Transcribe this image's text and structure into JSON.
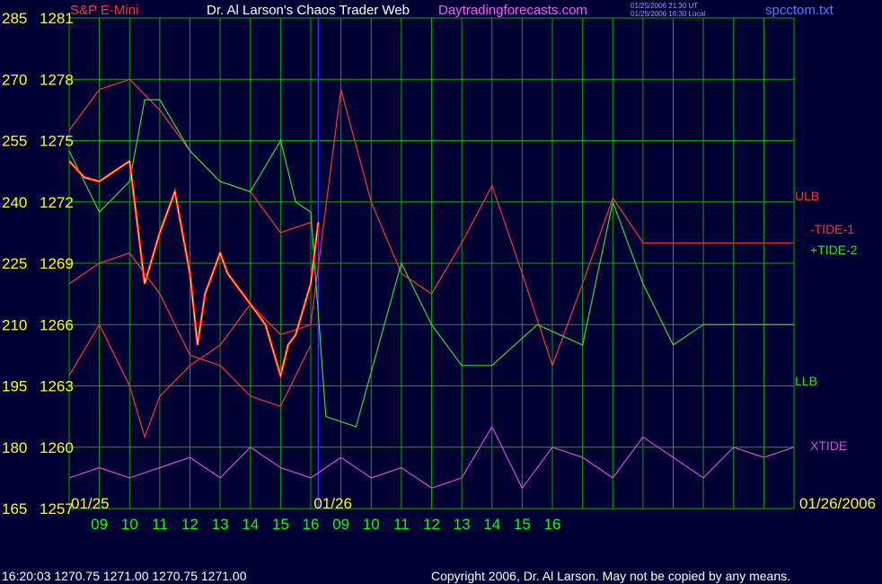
{
  "header": {
    "symbol": "S&P E-Mini",
    "title": "Dr. Al Larson's Chaos Trader Web",
    "site": "Daytradingforecasts.com",
    "timestamp_ut": "01/25/2006 21:30 UT",
    "timestamp_local": "01/25/2006 16:30 Local",
    "file": "spcctom.txt"
  },
  "footer": {
    "quote": "16:20:03  1270.75 1271.00 1270.75 1271.00",
    "copyright": "Copyright 2006, Dr. Al Larson. May not be copied by any means."
  },
  "colors": {
    "background": "#000033",
    "grid": "#00aa00",
    "price": "#ff0000",
    "price_up": "#ffffff",
    "ulb_llb": "#ff3333",
    "tide1": "#ff3333",
    "tide2": "#33dd33",
    "xtide": "#dd44dd",
    "axis_text": "#ffff00",
    "time_text": "#00ff00"
  },
  "chart_data": {
    "type": "line",
    "y_left_labels": [
      "285",
      "270",
      "255",
      "240",
      "225",
      "210",
      "195",
      "180",
      "165"
    ],
    "y_price_labels": [
      "1281",
      "1278",
      "1275",
      "1272",
      "1269",
      "1266",
      "1263",
      "1260",
      "1257"
    ],
    "ylim": [
      1257,
      1281
    ],
    "x_ticks": [
      "09",
      "10",
      "11",
      "12",
      "13",
      "14",
      "15",
      "16",
      "09",
      "10",
      "11",
      "12",
      "13",
      "14",
      "15",
      "16"
    ],
    "date_labels": [
      "01/25",
      "01/26",
      "01/26/2006"
    ],
    "xlim": [
      8.0,
      32.0
    ],
    "series_labels": [
      "ULB",
      "-TIDE-1",
      "+TIDE-2",
      "LLB",
      "XTIDE"
    ],
    "series": [
      {
        "name": "ULB",
        "x": [
          8.0,
          9.0,
          10.0,
          11.0,
          12.0,
          13.0,
          14.0,
          15.0,
          16.0
        ],
        "y": [
          1275.5,
          1277.5,
          1278.0,
          1276.5,
          1274.5,
          1273.0,
          1272.5,
          1270.5,
          1271.0
        ]
      },
      {
        "name": "LLB",
        "x": [
          8.0,
          9.0,
          10.0,
          11.0,
          12.0,
          13.0,
          14.0,
          15.0,
          16.0
        ],
        "y": [
          1268.0,
          1269.0,
          1269.5,
          1267.5,
          1264.5,
          1264.0,
          1262.5,
          1262.0,
          1265.0
        ]
      },
      {
        "name": "-TIDE-1",
        "x": [
          8.0,
          9.0,
          10.0,
          10.5,
          11.0,
          12.0,
          13.0,
          14.0,
          15.0,
          16.0,
          17.0,
          18.0,
          19.0,
          20.0,
          21.0,
          22.0,
          23.0,
          24.0,
          25.0,
          26.0,
          27.0,
          28.0,
          29.0,
          30.0,
          31.0,
          32.0
        ],
        "y": [
          1263.5,
          1266.0,
          1263.0,
          1260.5,
          1262.5,
          1264.0,
          1265.0,
          1267.0,
          1265.5,
          1266.0,
          1277.5,
          1272.0,
          1268.5,
          1267.5,
          1270.0,
          1272.8,
          1268.5,
          1264.0,
          1268.0,
          1272.2,
          1270.0,
          1270.0,
          1270.0,
          1270.0,
          1270.0,
          1270.0
        ]
      },
      {
        "name": "+TIDE-2",
        "x": [
          8.0,
          9.0,
          10.0,
          10.5,
          11.0,
          12.0,
          13.0,
          14.0,
          15.0,
          15.5,
          16.0,
          16.5,
          17.5,
          19.0,
          20.0,
          21.0,
          22.0,
          23.5,
          25.0,
          26.0,
          27.0,
          28.0,
          29.0,
          30.0,
          31.0,
          32.0
        ],
        "y": [
          1274.5,
          1271.5,
          1273.0,
          1277.0,
          1277.0,
          1274.5,
          1273.0,
          1272.5,
          1275.0,
          1272.0,
          1271.5,
          1261.5,
          1261.0,
          1269.0,
          1266.0,
          1264.0,
          1264.0,
          1266.0,
          1265.0,
          1272.0,
          1268.0,
          1265.0,
          1266.0,
          1266.0,
          1266.0,
          1266.0
        ]
      },
      {
        "name": "XTIDE",
        "x": [
          8.0,
          9.0,
          10.0,
          11.0,
          12.0,
          13.0,
          14.0,
          15.0,
          16.0,
          17.0,
          18.0,
          19.0,
          20.0,
          21.0,
          22.0,
          23.0,
          24.0,
          25.0,
          26.0,
          27.0,
          28.0,
          29.0,
          30.0,
          31.0,
          32.0
        ],
        "y": [
          1258.5,
          1259.0,
          1258.5,
          1259.0,
          1259.5,
          1258.5,
          1260.0,
          1259.0,
          1258.5,
          1259.5,
          1258.5,
          1259.0,
          1258.0,
          1258.5,
          1261.0,
          1258.0,
          1260.0,
          1259.5,
          1258.5,
          1260.5,
          1259.5,
          1258.5,
          1260.0,
          1259.5,
          1260.0
        ]
      },
      {
        "name": "price",
        "x": [
          8.0,
          8.5,
          9.0,
          9.5,
          10.0,
          10.25,
          10.5,
          11.0,
          11.5,
          12.0,
          12.25,
          12.5,
          13.0,
          13.25,
          13.5,
          14.0,
          14.5,
          15.0,
          15.25,
          15.5,
          16.0,
          16.25
        ],
        "y": [
          1274.0,
          1273.2,
          1273.0,
          1273.5,
          1274.0,
          1271.0,
          1268.0,
          1270.5,
          1272.5,
          1268.5,
          1265.0,
          1267.5,
          1269.5,
          1268.5,
          1268.0,
          1267.0,
          1266.0,
          1263.5,
          1265.0,
          1265.5,
          1268.0,
          1271.0
        ]
      }
    ]
  }
}
